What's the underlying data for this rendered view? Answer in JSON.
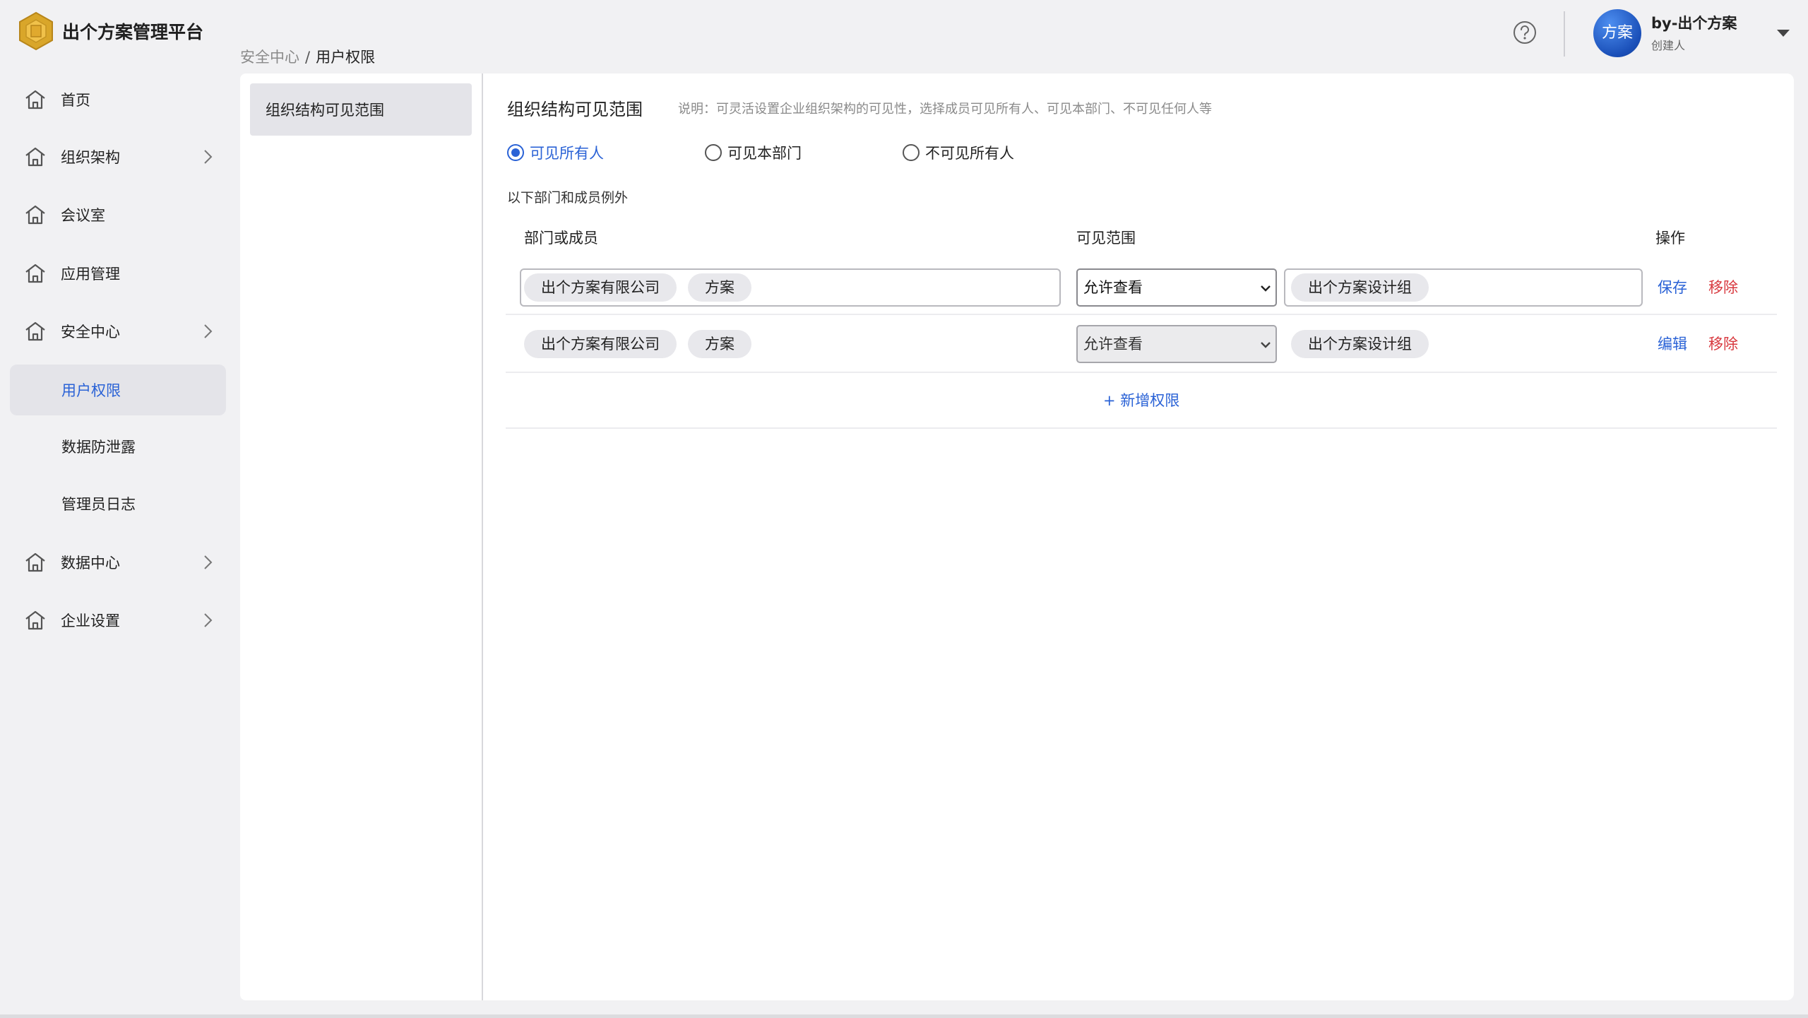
{
  "app": {
    "title": "出个方案管理平台"
  },
  "breadcrumb": {
    "parent": "安全中心",
    "separator": "/",
    "current": "用户权限"
  },
  "user": {
    "avatar_text": "方案",
    "name": "by-出个方案",
    "role": "创建人"
  },
  "sidebar": {
    "items": [
      {
        "label": "首页"
      },
      {
        "label": "组织架构"
      },
      {
        "label": "会议室"
      },
      {
        "label": "应用管理"
      },
      {
        "label": "安全中心"
      },
      {
        "label": "数据中心"
      },
      {
        "label": "企业设置"
      }
    ],
    "security_sub": [
      {
        "label": "用户权限",
        "active": true
      },
      {
        "label": "数据防泄露"
      },
      {
        "label": "管理员日志"
      }
    ]
  },
  "left_panel": {
    "tab_label": "组织结构可见范围"
  },
  "main": {
    "title": "组织结构可见范围",
    "description": "说明：可灵活设置企业组织架构的可见性，选择成员可见所有人、可见本部门、不可见任何人等",
    "radios": [
      {
        "label": "可见所有人",
        "checked": true
      },
      {
        "label": "可见本部门",
        "checked": false
      },
      {
        "label": "不可见所有人",
        "checked": false
      }
    ],
    "exception_label": "以下部门和成员例外",
    "columns": {
      "dept": "部门或成员",
      "scope": "可见范围",
      "action": "操作"
    },
    "rows": [
      {
        "tags": [
          "出个方案有限公司",
          "方案"
        ],
        "scope": "允许查看",
        "scope_tags": [
          "出个方案设计组"
        ],
        "action_primary": "保存",
        "action_remove": "移除"
      },
      {
        "tags": [
          "出个方案有限公司",
          "方案"
        ],
        "scope": "允许查看",
        "scope_tags": [
          "出个方案设计组"
        ],
        "action_primary": "编辑",
        "action_remove": "移除"
      }
    ],
    "add_label": "+ 新增权限"
  },
  "colors": {
    "accent": "#2a62d6",
    "danger": "#d8383e",
    "background": "#f1f1f3",
    "logo": "#d9a62a"
  },
  "icons": {
    "logo": "hexagon-logo-icon",
    "help": "question-circle-icon",
    "user_menu": "caret-down-icon",
    "nav": "home-icon",
    "nav_expand": "chevron-right-icon",
    "select": "chevron-down-icon"
  }
}
